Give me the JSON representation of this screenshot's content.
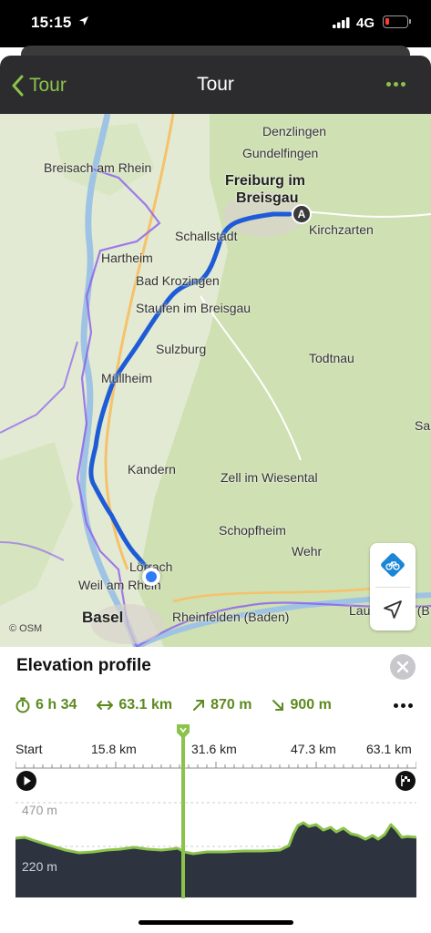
{
  "status_bar": {
    "time": "15:15",
    "network": "4G"
  },
  "header": {
    "back_label": "Tour",
    "title": "Tour"
  },
  "map": {
    "labels": {
      "denzlingen": "Denzlingen",
      "gundelfingen": "Gundelfingen",
      "breisach": "Breisach am Rhein",
      "freiburg_1": "Freiburg im",
      "freiburg_2": "Breisgau",
      "kirchzarten": "Kirchzarten",
      "hartheim": "Hartheim",
      "schallstadt": "Schallstadt",
      "bad_krozingen": "Bad Krozingen",
      "staufen": "Staufen im Breisgau",
      "sulzburg": "Sulzburg",
      "todtnau": "Todtnau",
      "muellheim": "Müllheim",
      "sa": "Sa",
      "kandern": "Kandern",
      "zell": "Zell im Wiesental",
      "schopfheim": "Schopfheim",
      "wehr": "Wehr",
      "loerrach": "Lörrach",
      "weil": "Weil am Rhein",
      "basel": "Basel",
      "rheinfelden": "Rheinfelden (Baden)",
      "laufenburg": "Laufenburg (B"
    },
    "start_marker": "A",
    "attribution": "© OSM",
    "colors": {
      "route": "#1e5bd6",
      "border": "#8a5cf0",
      "water": "#9fc3e4",
      "forest": "#cfe0b3"
    }
  },
  "elevation": {
    "title": "Elevation profile",
    "duration": "6 h 34",
    "distance": "63.1 km",
    "ascent": "870 m",
    "descent": "900 m",
    "axis_labels": [
      "Start",
      "15.8 km",
      "31.6 km",
      "47.3 km",
      "63.1 km"
    ],
    "y_high": "470 m",
    "y_low": "220 m",
    "accent": "#8bc34a"
  }
}
